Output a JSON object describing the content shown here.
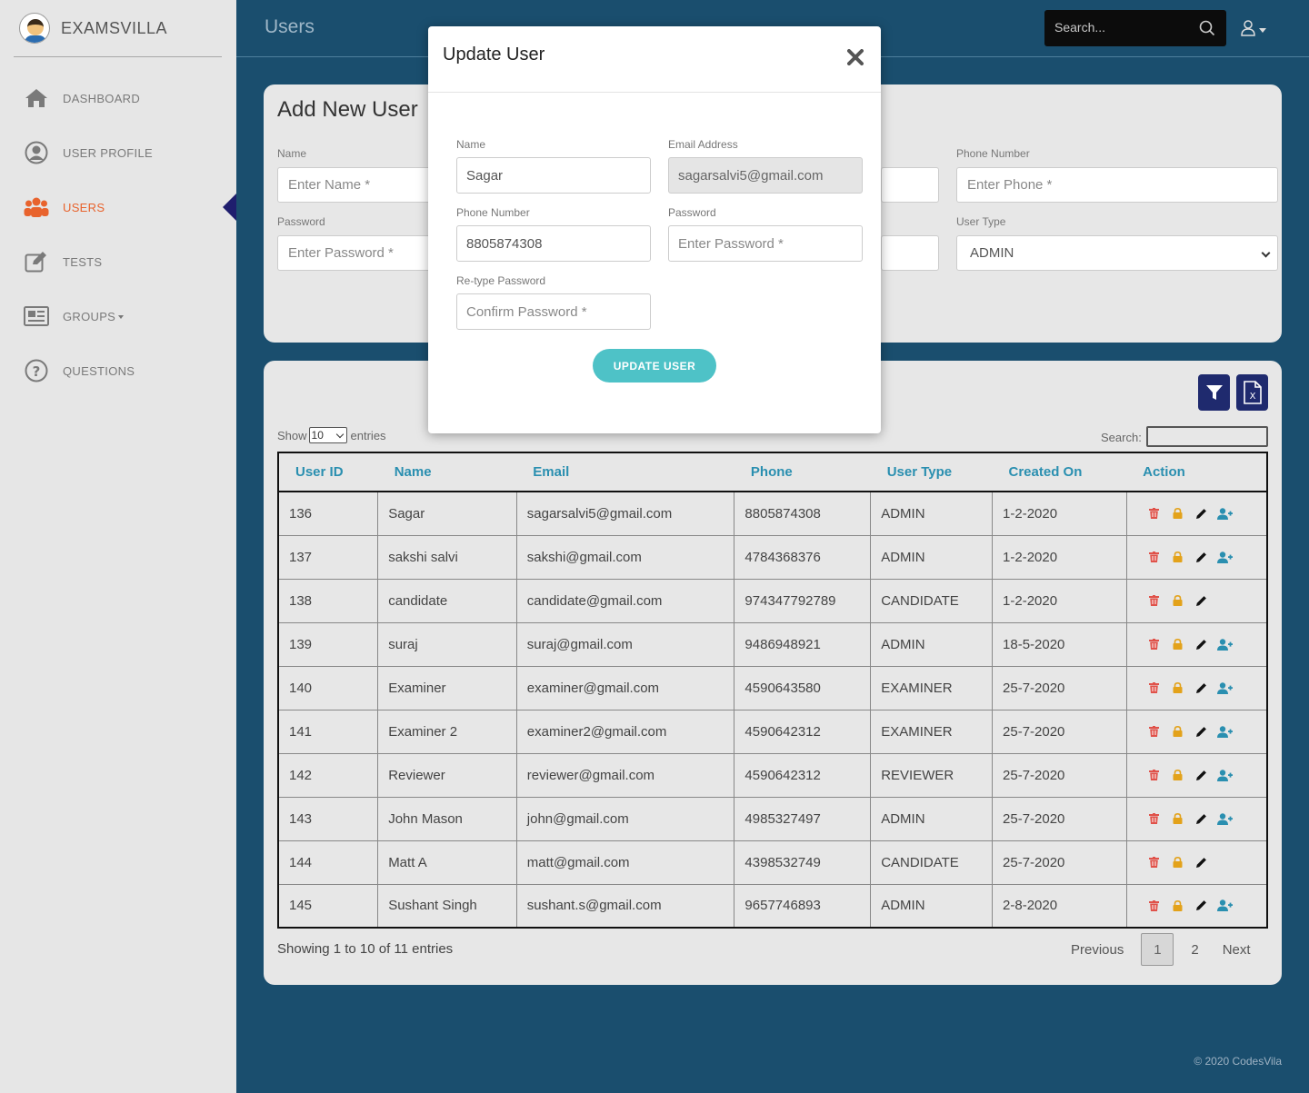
{
  "app": {
    "brand": "EXAMSVILLA",
    "page_title": "Users",
    "footer": "© 2020 CodesVila"
  },
  "colors": {
    "accent": "#e8632d",
    "topbar_bg": "#1a4e6e",
    "tool_btn": "#1f2a6e",
    "teal": "#4ec2c7",
    "table_header": "#2a8fb0"
  },
  "sidebar": {
    "items": [
      {
        "label": "DASHBOARD",
        "icon": "home-icon"
      },
      {
        "label": "USER PROFILE",
        "icon": "user-circle-icon"
      },
      {
        "label": "USERS",
        "icon": "users-icon",
        "active": true
      },
      {
        "label": "TESTS",
        "icon": "edit-icon"
      },
      {
        "label": "GROUPS",
        "icon": "newspaper-icon"
      },
      {
        "label": "QUESTIONS",
        "icon": "question-icon"
      }
    ]
  },
  "topbar": {
    "search_placeholder": "Search..."
  },
  "add_user": {
    "title": "Add New User",
    "name_label": "Name",
    "name_placeholder": "Enter Name *",
    "phone_label": "Phone Number",
    "phone_placeholder": "Enter Phone *",
    "password_label": "Password",
    "password_placeholder": "Enter Password *",
    "user_type_label": "User Type",
    "user_type_value": "ADMIN"
  },
  "table": {
    "show_label": "Show",
    "page_size": "10",
    "entries_label": "entries",
    "search_label": "Search:",
    "columns": [
      "User ID",
      "Name",
      "Email",
      "Phone",
      "User Type",
      "Created On",
      "Action"
    ],
    "rows": [
      {
        "id": "136",
        "name": "Sagar",
        "email": "sagarsalvi5@gmail.com",
        "phone": "8805874308",
        "type": "ADMIN",
        "created": "1-2-2020",
        "assign": true
      },
      {
        "id": "137",
        "name": "sakshi salvi",
        "email": "sakshi@gmail.com",
        "phone": "4784368376",
        "type": "ADMIN",
        "created": "1-2-2020",
        "assign": true
      },
      {
        "id": "138",
        "name": "candidate",
        "email": "candidate@gmail.com",
        "phone": "974347792789",
        "type": "CANDIDATE",
        "created": "1-2-2020",
        "assign": false
      },
      {
        "id": "139",
        "name": "suraj",
        "email": "suraj@gmail.com",
        "phone": "9486948921",
        "type": "ADMIN",
        "created": "18-5-2020",
        "assign": true
      },
      {
        "id": "140",
        "name": "Examiner",
        "email": "examiner@gmail.com",
        "phone": "4590643580",
        "type": "EXAMINER",
        "created": "25-7-2020",
        "assign": true
      },
      {
        "id": "141",
        "name": "Examiner 2",
        "email": "examiner2@gmail.com",
        "phone": "4590642312",
        "type": "EXAMINER",
        "created": "25-7-2020",
        "assign": true
      },
      {
        "id": "142",
        "name": "Reviewer",
        "email": "reviewer@gmail.com",
        "phone": "4590642312",
        "type": "REVIEWER",
        "created": "25-7-2020",
        "assign": true
      },
      {
        "id": "143",
        "name": "John Mason",
        "email": "john@gmail.com",
        "phone": "4985327497",
        "type": "ADMIN",
        "created": "25-7-2020",
        "assign": true
      },
      {
        "id": "144",
        "name": "Matt A",
        "email": "matt@gmail.com",
        "phone": "4398532749",
        "type": "CANDIDATE",
        "created": "25-7-2020",
        "assign": false
      },
      {
        "id": "145",
        "name": "Sushant Singh",
        "email": "sushant.s@gmail.com",
        "phone": "9657746893",
        "type": "ADMIN",
        "created": "2-8-2020",
        "assign": true
      }
    ],
    "info": "Showing 1 to 10 of 11 entries",
    "pagination": {
      "previous": "Previous",
      "pages": [
        "1",
        "2"
      ],
      "current": "1",
      "next": "Next"
    }
  },
  "modal": {
    "title": "Update User",
    "name_label": "Name",
    "name_value": "Sagar",
    "email_label": "Email Address",
    "email_value": "sagarsalvi5@gmail.com",
    "phone_label": "Phone Number",
    "phone_value": "8805874308",
    "password_label": "Password",
    "password_placeholder": "Enter Password *",
    "retype_label": "Re-type Password",
    "retype_placeholder": "Confirm Password *",
    "submit_label": "UPDATE USER"
  }
}
